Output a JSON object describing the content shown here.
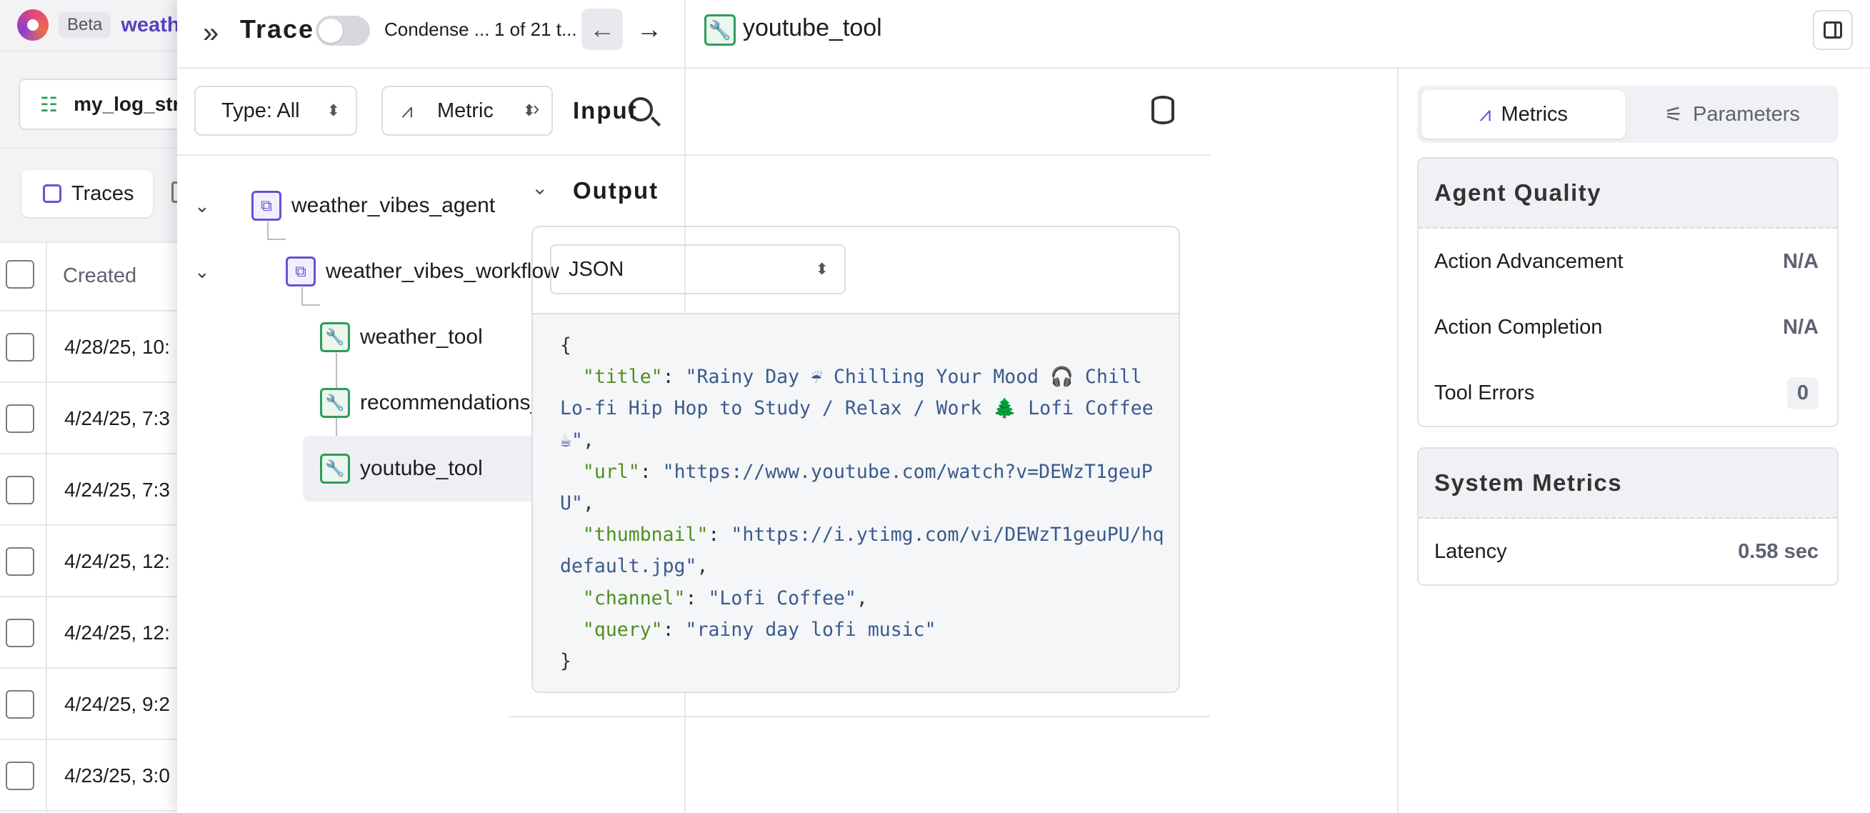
{
  "app": {
    "beta_label": "Beta",
    "project_name": "weath"
  },
  "log_stream": {
    "name": "my_log_str"
  },
  "view_tabs": {
    "traces_label": "Traces"
  },
  "table": {
    "created_header": "Created",
    "rows": [
      "4/28/25, 10:",
      "4/24/25, 7:3",
      "4/24/25, 7:3",
      "4/24/25, 12:",
      "4/24/25, 12:",
      "4/24/25, 9:2",
      "4/23/25, 3:0"
    ]
  },
  "drawer": {
    "title": "Trace",
    "condense_label": "Condense ...",
    "counter": "1 of 21 t...",
    "span_title": "youtube_tool"
  },
  "filters": {
    "type_label": "Type: All",
    "metric_label": "Metric"
  },
  "tree": {
    "nodes": [
      {
        "label": "weather_vibes_agent",
        "kind": "agent"
      },
      {
        "label": "weather_vibes_workflow",
        "kind": "workflow"
      },
      {
        "label": "weather_tool",
        "kind": "tool"
      },
      {
        "label": "recommendations_tool",
        "kind": "tool"
      },
      {
        "label": "youtube_tool",
        "kind": "tool",
        "selected": true
      }
    ]
  },
  "input_section": {
    "title": "Input"
  },
  "output_section": {
    "title": "Output",
    "format": "JSON",
    "json": {
      "title": "Rainy Day ☔ Chilling Your Mood 🎧 Chill Lo-fi Hip Hop to Study / Relax / Work 🌲 Lofi Coffee ☕",
      "url": "https://www.youtube.com/watch?v=DEWzT1geuPU",
      "thumbnail": "https://i.ytimg.com/vi/DEWzT1geuPU/hqdefault.jpg",
      "channel": "Lofi Coffee",
      "query": "rainy day lofi music"
    }
  },
  "metrics_panel": {
    "tabs": {
      "metrics": "Metrics",
      "parameters": "Parameters"
    },
    "agent_quality": {
      "title": "Agent Quality",
      "rows": [
        {
          "label": "Action Advancement",
          "value": "N/A"
        },
        {
          "label": "Action Completion",
          "value": "N/A"
        },
        {
          "label": "Tool Errors",
          "value": "0"
        }
      ]
    },
    "system_metrics": {
      "title": "System Metrics",
      "rows": [
        {
          "label": "Latency",
          "value": "0.58 sec"
        }
      ]
    }
  },
  "colors": {
    "accent": "#6b4fd6",
    "tool_green": "#2d9c5a",
    "json_key": "#4f8f1f",
    "json_string": "#3a5a8c"
  }
}
